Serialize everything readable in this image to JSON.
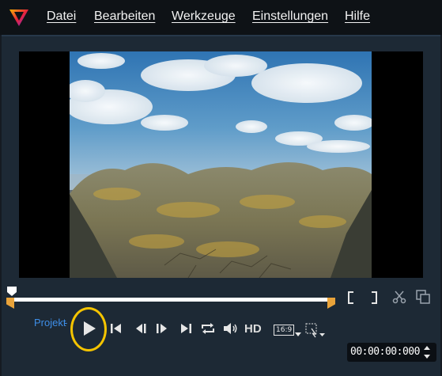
{
  "menu": {
    "items": [
      "Datei",
      "Bearbeiten",
      "Werkzeuge",
      "Einstellungen",
      "Hilfe"
    ]
  },
  "player": {
    "mode_project_label": "Projekt",
    "mode_clip_label": "-",
    "hd_label": "HD",
    "aspect_label": "16:9",
    "timecode": "00:00:00:000"
  },
  "icons": [
    "app-logo-icon",
    "trim-start-bracket-icon",
    "trim-end-bracket-icon",
    "scissors-icon",
    "snapshot-icon",
    "play-icon",
    "go-to-start-icon",
    "previous-frame-icon",
    "next-frame-icon",
    "go-to-end-icon",
    "repeat-icon",
    "volume-icon",
    "resize-crop-icon",
    "timecode-spin-icon"
  ],
  "colors": {
    "accent_blue": "#3e8ee8",
    "trim_marker": "#e9a33a",
    "highlight_ring": "#f5c400"
  }
}
